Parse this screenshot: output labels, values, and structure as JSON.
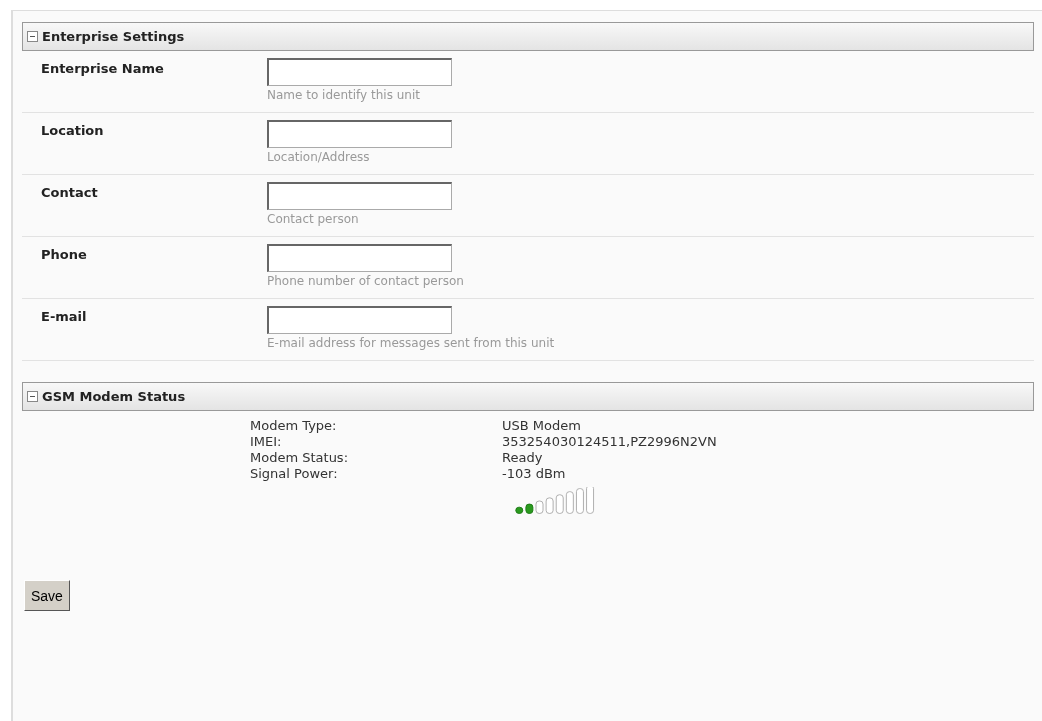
{
  "sections": [
    {
      "kind": "form",
      "title": "Enterprise Settings",
      "expanded": true,
      "fields": [
        {
          "label": "Enterprise Name",
          "hint": "Name to identify this unit"
        },
        {
          "label": "Location",
          "hint": "Location/Address"
        },
        {
          "label": "Contact",
          "hint": "Contact person"
        },
        {
          "label": "Phone",
          "hint": "Phone number of contact person"
        },
        {
          "label": "E-mail",
          "hint": "E-mail address for messages sent from this unit"
        }
      ]
    },
    {
      "kind": "status",
      "title": "GSM Modem Status",
      "expanded": true,
      "items": [
        {
          "label": "Modem Type:",
          "value": "USB Modem"
        },
        {
          "label": "IMEI:",
          "value": "353254030124511,PZ2996N2VN"
        },
        {
          "label": "Modem Status:",
          "value": "Ready"
        },
        {
          "label": "Signal Power:",
          "value": "-103 dBm"
        }
      ]
    }
  ],
  "buttons": [
    "Save"
  ]
}
